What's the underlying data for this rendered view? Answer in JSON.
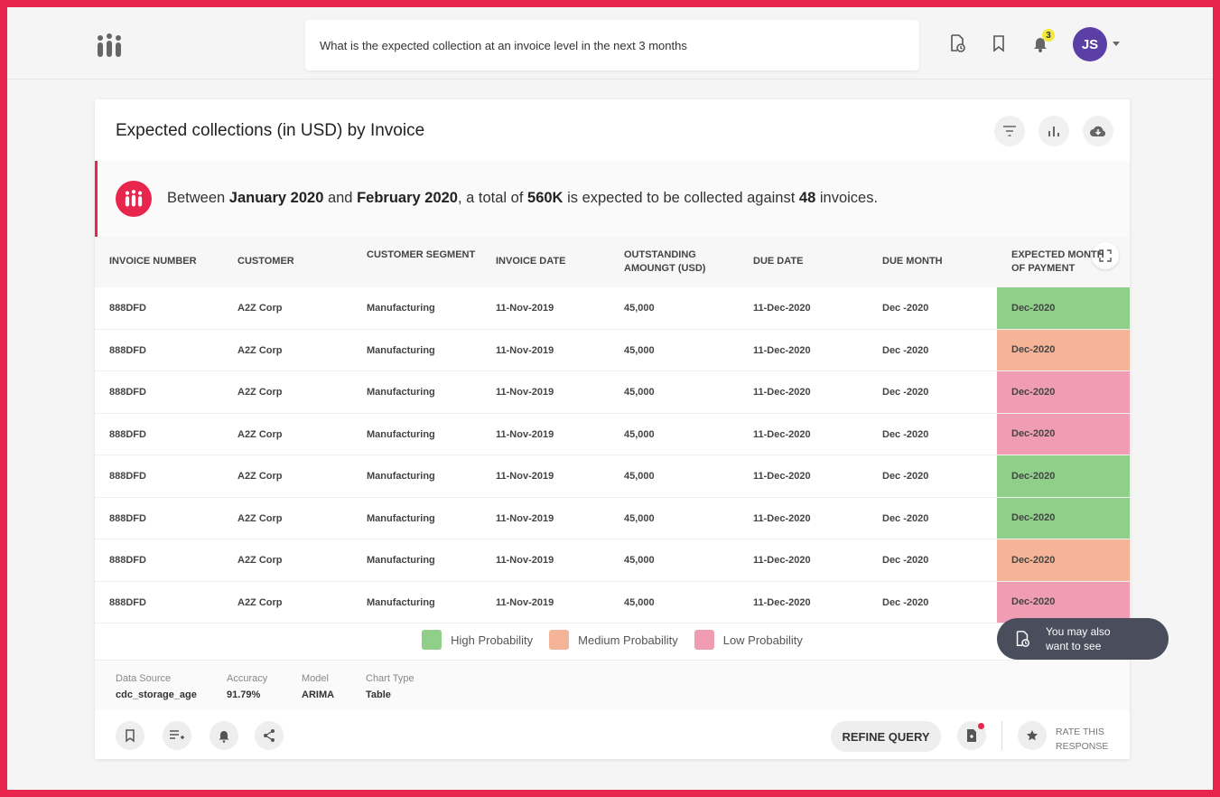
{
  "colors": {
    "brand": "#e8254d",
    "high": "#8fcf8a",
    "medium": "#f5b497",
    "low": "#f09db3",
    "avatar": "#5b3fa6"
  },
  "header": {
    "query": "What is the expected collection at an invoice level in the next 3 months",
    "notification_count": "3",
    "user_initials": "JS"
  },
  "card": {
    "title": "Expected collections (in USD) by Invoice",
    "insight": {
      "prefix": "Between ",
      "start": "January 2020",
      "mid": " and ",
      "end": "February 2020",
      "middle": ", a total of ",
      "amount": "560K",
      "suffix": " is expected to be collected against ",
      "count": "48",
      "tail": " invoices."
    }
  },
  "table": {
    "headers": [
      "INVOICE NUMBER",
      "CUSTOMER",
      "CUSTOMER SEGMENT",
      "INVOICE DATE",
      "OUTSTANDING AMOUNGT (USD)",
      "DUE DATE",
      "DUE MONTH",
      "EXPECTED MONTH OF PAYMENT"
    ],
    "rows": [
      {
        "invoice": "888DFD",
        "customer": "A2Z Corp",
        "segment": "Manufacturing",
        "invoice_date": "11-Nov-2019",
        "outstanding": "45,000",
        "due_date": "11-Dec-2020",
        "due_month": "Dec -2020",
        "expected": "Dec-2020",
        "probability": "high"
      },
      {
        "invoice": "888DFD",
        "customer": "A2Z Corp",
        "segment": "Manufacturing",
        "invoice_date": "11-Nov-2019",
        "outstanding": "45,000",
        "due_date": "11-Dec-2020",
        "due_month": "Dec -2020",
        "expected": "Dec-2020",
        "probability": "medium"
      },
      {
        "invoice": "888DFD",
        "customer": "A2Z Corp",
        "segment": "Manufacturing",
        "invoice_date": "11-Nov-2019",
        "outstanding": "45,000",
        "due_date": "11-Dec-2020",
        "due_month": "Dec -2020",
        "expected": "Dec-2020",
        "probability": "low"
      },
      {
        "invoice": "888DFD",
        "customer": "A2Z Corp",
        "segment": "Manufacturing",
        "invoice_date": "11-Nov-2019",
        "outstanding": "45,000",
        "due_date": "11-Dec-2020",
        "due_month": "Dec -2020",
        "expected": "Dec-2020",
        "probability": "low"
      },
      {
        "invoice": "888DFD",
        "customer": "A2Z Corp",
        "segment": "Manufacturing",
        "invoice_date": "11-Nov-2019",
        "outstanding": "45,000",
        "due_date": "11-Dec-2020",
        "due_month": "Dec -2020",
        "expected": "Dec-2020",
        "probability": "high"
      },
      {
        "invoice": "888DFD",
        "customer": "A2Z Corp",
        "segment": "Manufacturing",
        "invoice_date": "11-Nov-2019",
        "outstanding": "45,000",
        "due_date": "11-Dec-2020",
        "due_month": "Dec -2020",
        "expected": "Dec-2020",
        "probability": "high"
      },
      {
        "invoice": "888DFD",
        "customer": "A2Z Corp",
        "segment": "Manufacturing",
        "invoice_date": "11-Nov-2019",
        "outstanding": "45,000",
        "due_date": "11-Dec-2020",
        "due_month": "Dec -2020",
        "expected": "Dec-2020",
        "probability": "medium"
      },
      {
        "invoice": "888DFD",
        "customer": "A2Z Corp",
        "segment": "Manufacturing",
        "invoice_date": "11-Nov-2019",
        "outstanding": "45,000",
        "due_date": "11-Dec-2020",
        "due_month": "Dec -2020",
        "expected": "Dec-2020",
        "probability": "low"
      }
    ]
  },
  "legend": {
    "high": "High Probability",
    "medium": "Medium Probability",
    "low": "Low Probability"
  },
  "meta": {
    "data_source_label": "Data Source",
    "data_source": "cdc_storage_age",
    "accuracy_label": "Accuracy",
    "accuracy": "91.79%",
    "model_label": "Model",
    "model": "ARIMA",
    "chart_type_label": "Chart Type",
    "chart_type": "Table"
  },
  "footer": {
    "refine": "REFINE QUERY",
    "rate_line1": "RATE THIS",
    "rate_line2": "RESPONSE"
  },
  "tooltip": {
    "line1": "You may also",
    "line2": "want to see"
  }
}
